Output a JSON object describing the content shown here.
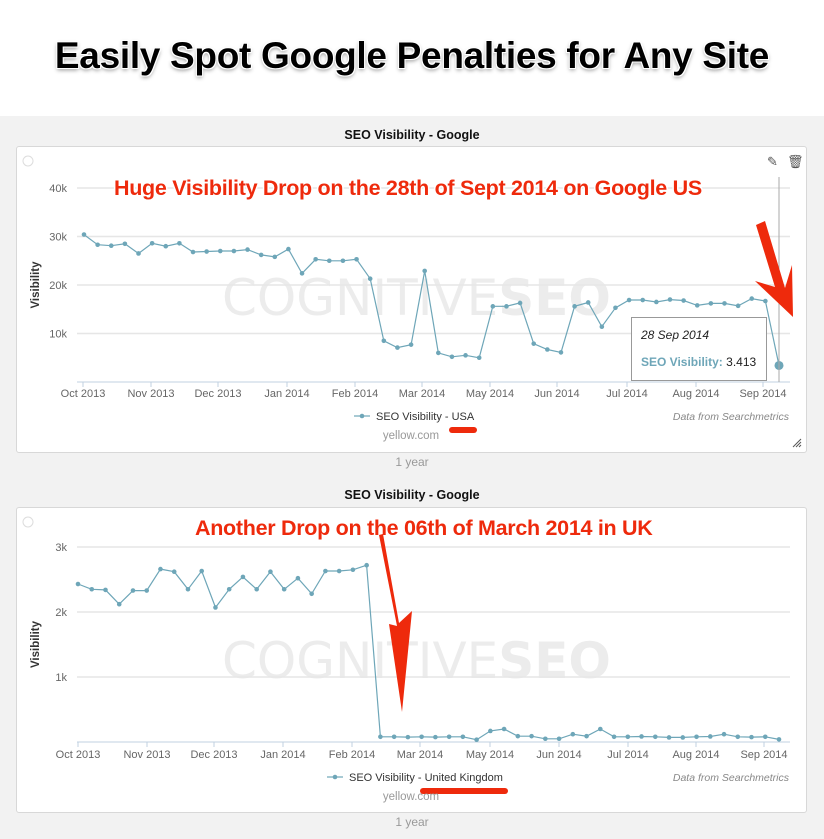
{
  "headline": "Easily Spot Google Penalties for Any Site",
  "colors": {
    "series": "#6ea6b8",
    "annotation": "#ee2a0c",
    "grid": "#e6e6e6",
    "axis": "#c0d0e0"
  },
  "toolbar": {
    "edit_icon": "pencil-icon",
    "delete_icon": "trash-icon"
  },
  "chart_data": [
    {
      "type": "line",
      "title": "SEO Visibility - Google",
      "annotation": "Huge Visibility Drop on the 28th of Sept 2014 on Google US",
      "ylabel": "Visibility",
      "xlabel": "",
      "yticks": [
        "10k",
        "20k",
        "30k",
        "40k"
      ],
      "ytick_values": [
        10000,
        20000,
        30000,
        40000
      ],
      "ylim": [
        0,
        40000
      ],
      "xticks": [
        "Oct 2013",
        "Nov 2013",
        "Dec 2013",
        "Jan 2014",
        "Feb 2014",
        "Mar 2014",
        "May 2014",
        "Jun 2014",
        "Jul 2014",
        "Aug 2014",
        "Sep 2014"
      ],
      "grid": true,
      "legend": {
        "placement": "bottom-center",
        "series_prefix": "SEO Visibility - ",
        "series_suffix": "USA"
      },
      "domain_label": "yellow.com",
      "credit": "Data from Searchmetrics",
      "range_label": "1 year",
      "watermark": {
        "light": "COGNITIVE",
        "bold": "SEO"
      },
      "tooltip": {
        "date": "28 Sep 2014",
        "series_label": "SEO Visibility:",
        "value": "3.413"
      },
      "series": [
        {
          "name": "SEO Visibility - USA",
          "weekly": true,
          "values": [
            30400,
            28300,
            28100,
            28500,
            26500,
            28600,
            28000,
            28600,
            26800,
            26900,
            27000,
            27000,
            27300,
            26200,
            25800,
            27400,
            22400,
            25300,
            25000,
            25000,
            25300,
            21300,
            8500,
            7100,
            7700,
            22900,
            6000,
            5200,
            5500,
            5000,
            15600,
            15600,
            16300,
            7900,
            6700,
            6100,
            15600,
            16400,
            11400,
            15300,
            16900,
            16900,
            16500,
            17000,
            16800,
            15800,
            16200,
            16200,
            15700,
            17200,
            16700,
            3413
          ]
        }
      ]
    },
    {
      "type": "line",
      "title": "SEO Visibility - Google",
      "annotation": "Another Drop on the 06th of March 2014 in UK",
      "ylabel": "Visibility",
      "xlabel": "",
      "yticks": [
        "1k",
        "2k",
        "3k"
      ],
      "ytick_values": [
        1000,
        2000,
        3000
      ],
      "ylim": [
        0,
        3000
      ],
      "xticks": [
        "Oct 2013",
        "Nov 2013",
        "Dec 2013",
        "Jan 2014",
        "Feb 2014",
        "Mar 2014",
        "May 2014",
        "Jun 2014",
        "Jul 2014",
        "Aug 2014",
        "Sep 2014"
      ],
      "grid": true,
      "legend": {
        "placement": "bottom-center",
        "series_prefix": "SEO Visibility - ",
        "series_suffix": "United Kingdom"
      },
      "domain_label": "yellow.com",
      "credit": "Data from Searchmetrics",
      "range_label": "1 year",
      "watermark": {
        "light": "COGNITIVE",
        "bold": "SEO"
      },
      "series": [
        {
          "name": "SEO Visibility - United Kingdom",
          "weekly": true,
          "values": [
            2430,
            2350,
            2340,
            2120,
            2330,
            2330,
            2660,
            2620,
            2350,
            2630,
            2070,
            2350,
            2540,
            2350,
            2620,
            2350,
            2520,
            2280,
            2630,
            2630,
            2650,
            2720,
            80,
            80,
            75,
            80,
            75,
            80,
            80,
            35,
            170,
            200,
            90,
            90,
            50,
            50,
            120,
            90,
            200,
            80,
            80,
            85,
            80,
            70,
            70,
            80,
            85,
            120,
            80,
            75,
            80,
            40
          ]
        }
      ]
    }
  ]
}
